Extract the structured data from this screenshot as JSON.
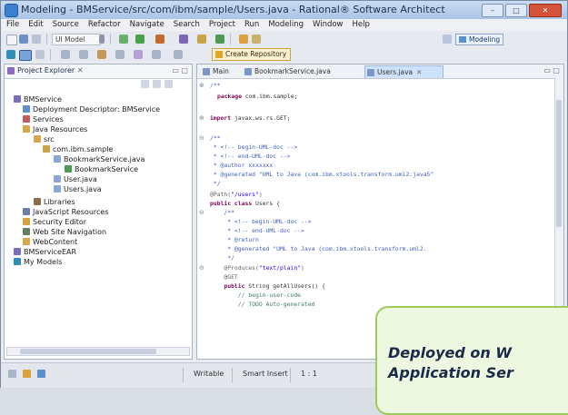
{
  "window": {
    "title": "Modeling - BMService/src/com/ibm/sample/Users.java - Rational® Software Architect",
    "controls": [
      "–",
      "□",
      "✕"
    ]
  },
  "menu": [
    "File",
    "Edit",
    "Source",
    "Refactor",
    "Navigate",
    "Search",
    "Project",
    "Run",
    "Modeling",
    "Window",
    "Help"
  ],
  "toolbar": {
    "model_dropdown": "UI Model",
    "inline_button": "Create Repository",
    "perspective": "Modeling"
  },
  "explorer": {
    "title": "Project Explorer",
    "close": "✕",
    "tree": [
      {
        "label": "BMService",
        "icon": "project-icon"
      },
      {
        "label": "Deployment Descriptor: BMService",
        "icon": "descriptor-icon"
      },
      {
        "label": "Services",
        "icon": "services-icon"
      },
      {
        "label": "Java Resources",
        "icon": "folder-icon"
      },
      {
        "label": "src",
        "icon": "source-folder-icon"
      },
      {
        "label": "com.ibm.sample",
        "icon": "package-icon"
      },
      {
        "label": "BookmarkService.java",
        "icon": "java-file-icon"
      },
      {
        "label": "BookmarkService",
        "icon": "class-icon"
      },
      {
        "label": "User.java",
        "icon": "java-file-icon"
      },
      {
        "label": "Users.java",
        "icon": "java-file-icon"
      },
      {
        "label": "Libraries",
        "icon": "library-icon"
      },
      {
        "label": "JavaScript Resources",
        "icon": "js-resources-icon"
      },
      {
        "label": "Security Editor",
        "icon": "security-icon"
      },
      {
        "label": "Web Site Navigation",
        "icon": "navigation-icon"
      },
      {
        "label": "WebContent",
        "icon": "folder-icon"
      },
      {
        "label": "BMServiceEAR",
        "icon": "ear-icon"
      },
      {
        "label": "My Models",
        "icon": "model-icon"
      }
    ]
  },
  "editor": {
    "tabs": [
      {
        "label": "Main"
      },
      {
        "label": "BookmarkService.java"
      },
      {
        "label": "Users.java",
        "close": "✕"
      }
    ],
    "code": [
      "/**",
      "package com.ibm.sample;",
      "",
      "import javax.ws.rs.GET;",
      "",
      "/**",
      " * <!-- begin-UML-doc -->",
      " * <!-- end-UML-doc -->",
      " * @author xxxxxxx",
      " * @generated \"UML to Java (com.ibm.xtools.transform.uml2.java5\"",
      " */",
      "@Path(\"/users\")",
      "public class Users {",
      "    /**",
      "     * <!-- begin-UML-doc -->",
      "     * <!-- end-UML-doc -->",
      "     * @return",
      "     * @generated \"UML to Java (com.ibm.xtools.transform.uml2.",
      "     */",
      "    @Produces(\"text/plain\")",
      "    @GET",
      "    public String getAllUsers() {",
      "        // begin-user-code",
      "        // TODO Auto-generated"
    ]
  },
  "statusbar": {
    "writable": "Writable",
    "insert_mode": "Smart Insert",
    "position": "1 : 1"
  },
  "callout": {
    "line1": "Deployed on W",
    "line2": "Application Ser"
  }
}
